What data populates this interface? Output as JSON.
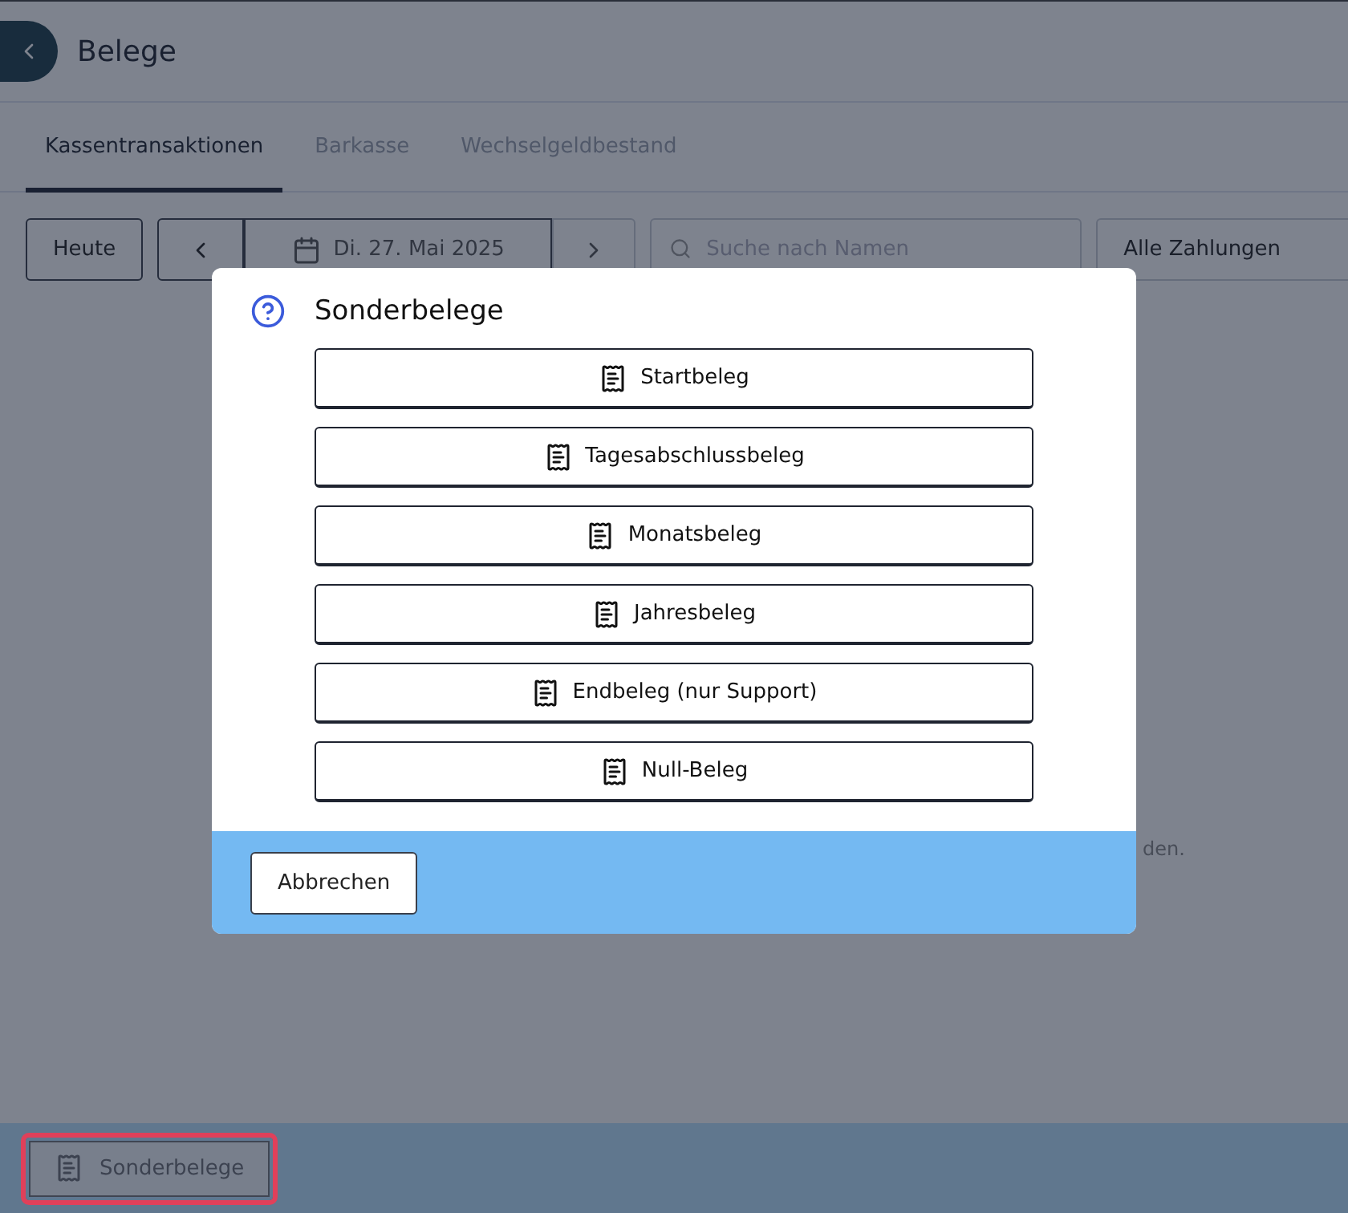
{
  "header": {
    "title": "Belege"
  },
  "tabs": [
    {
      "label": "Kassentransaktionen",
      "selected": true
    },
    {
      "label": "Barkasse",
      "selected": false
    },
    {
      "label": "Wechselgeldbestand",
      "selected": false
    }
  ],
  "toolbar": {
    "today": "Heute",
    "date": "Di. 27. Mai 2025",
    "search": {
      "placeholder": "Suche nach Namen"
    },
    "filter": "Alle Zahlungen"
  },
  "empty_message": "den.",
  "footer": {
    "button": {
      "label": "Sonderbelege",
      "focused": true
    }
  },
  "dialog": {
    "title": "Sonderbelege",
    "options": [
      "Startbeleg",
      "Tagesabschlussbeleg",
      "Monatsbeleg",
      "Jahresbeleg",
      "Endbeleg (nur Support)",
      "Null-Beleg"
    ],
    "cancel": "Abbrechen"
  }
}
